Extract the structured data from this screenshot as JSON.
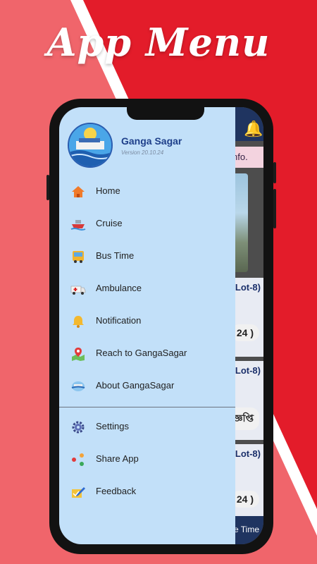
{
  "headline": "App Menu",
  "colors": {
    "accent_red": "#e31c2a",
    "light_red": "#f0656b",
    "drawer_bg": "#c2e0f9",
    "title_blue": "#1e3f8a"
  },
  "drawer": {
    "app_name": "Ganga Sagar",
    "version": "Version 20.10.24",
    "items_primary": [
      {
        "label": "Home",
        "icon": "home-icon"
      },
      {
        "label": "Cruise",
        "icon": "ship-icon"
      },
      {
        "label": "Bus Time",
        "icon": "bus-icon"
      },
      {
        "label": "Ambulance",
        "icon": "ambulance-icon"
      },
      {
        "label": "Notification",
        "icon": "bell-icon"
      },
      {
        "label": "Reach to GangaSagar",
        "icon": "map-pin-icon"
      },
      {
        "label": "About GangaSagar",
        "icon": "info-globe-icon"
      }
    ],
    "items_secondary": [
      {
        "label": "Settings",
        "icon": "gear-icon"
      },
      {
        "label": "Share App",
        "icon": "share-icon"
      },
      {
        "label": "Feedback",
        "icon": "feedback-icon"
      }
    ]
  },
  "background_app": {
    "info_text": "nfo.",
    "card1_title": "Lot-8)",
    "card1_pill": "24 )",
    "card2_title": "Lot-8)",
    "card2_text": "জ্ঞপ্তি",
    "card3_title": "Lot-8)",
    "card3_pill": "24 )",
    "bottom_text": "e Time"
  }
}
